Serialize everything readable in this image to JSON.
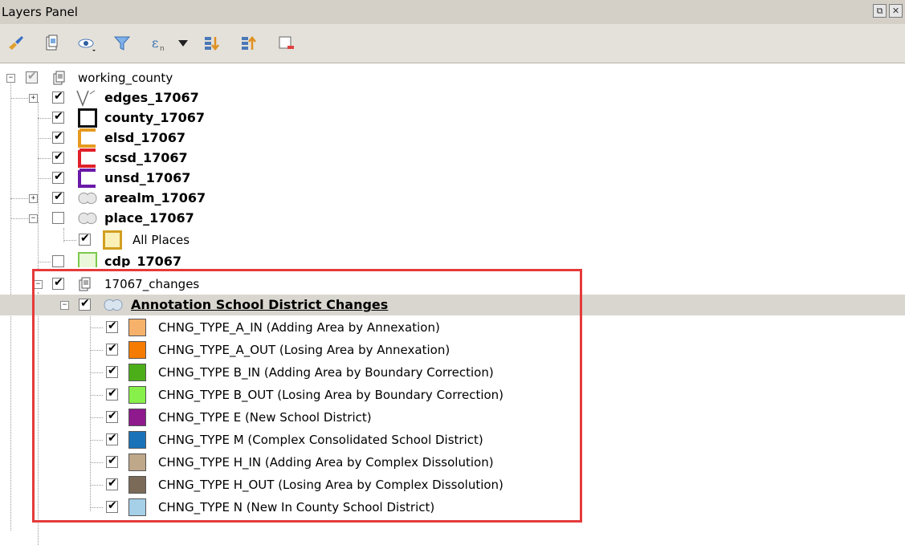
{
  "panel": {
    "title": "Layers Panel",
    "float_btn": "⧉",
    "close_btn": "✕"
  },
  "toolbar": {
    "icons": [
      "brush-icon",
      "add-group-icon",
      "visibility-icon",
      "filter-icon",
      "expression-icon",
      "dropdown-arrow-icon",
      "expand-all-icon",
      "collapse-all-icon",
      "remove-layer-icon"
    ]
  },
  "layers": {
    "group1": {
      "label": "working_county"
    },
    "edges": {
      "label": "edges_17067"
    },
    "county": {
      "label": "county_17067"
    },
    "elsd": {
      "label": "elsd_17067"
    },
    "scsd": {
      "label": "scsd_17067"
    },
    "unsd": {
      "label": "unsd_17067"
    },
    "arealm": {
      "label": "arealm_17067"
    },
    "place": {
      "label": "place_17067"
    },
    "all_places": {
      "label": "All Places"
    },
    "cdp": {
      "label": "cdp_17067"
    },
    "group2": {
      "label": "17067_changes"
    },
    "annotation": {
      "label": "Annotation School District Changes"
    }
  },
  "change_types": [
    {
      "label": "CHNG_TYPE_A_IN (Adding Area by Annexation)",
      "color": "#f6b26b"
    },
    {
      "label": "CHNG_TYPE_A_OUT (Losing Area by Annexation)",
      "color": "#f57c00"
    },
    {
      "label": "CHNG_TYPE B_IN (Adding Area by Boundary Correction)",
      "color": "#4caf1a"
    },
    {
      "label": "CHNG_TYPE B_OUT (Losing Area by Boundary Correction)",
      "color": "#88f04a"
    },
    {
      "label": "CHNG_TYPE E (New School District)",
      "color": "#8e1a8e"
    },
    {
      "label": "CHNG_TYPE M (Complex Consolidated School District)",
      "color": "#1a72b8"
    },
    {
      "label": "CHNG_TYPE H_IN (Adding Area by Complex Dissolution)",
      "color": "#bfa78a"
    },
    {
      "label": "CHNG_TYPE H_OUT (Losing Area by Complex Dissolution)",
      "color": "#7b6a58"
    },
    {
      "label": "CHNG_TYPE N (New In County School District)",
      "color": "#a6cfe8"
    }
  ],
  "colors": {
    "highlight_border": "#e53a3a",
    "selected_row": "#d9d6cf"
  }
}
